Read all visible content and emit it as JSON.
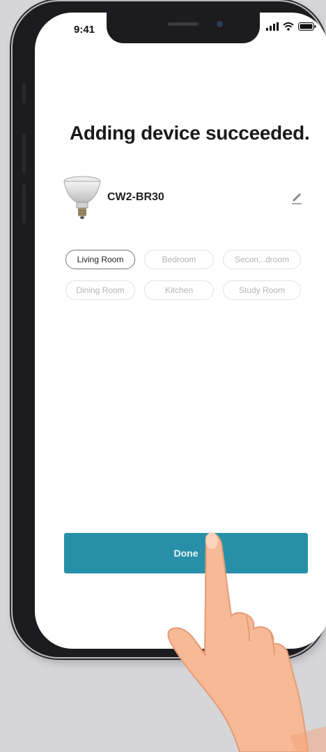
{
  "status_bar": {
    "time": "9:41"
  },
  "page": {
    "title": "Adding device succeeded."
  },
  "device": {
    "name": "CW2-BR30"
  },
  "rooms": [
    {
      "label": "Living Room",
      "selected": true
    },
    {
      "label": "Bedroom",
      "selected": false
    },
    {
      "label": "Secon...droom",
      "selected": false
    },
    {
      "label": "Dining Room",
      "selected": false
    },
    {
      "label": "Kitchen",
      "selected": false
    },
    {
      "label": "Study Room",
      "selected": false
    }
  ],
  "actions": {
    "done_label": "Done"
  },
  "colors": {
    "accent": "#2790a8",
    "chip_selected_border": "#777777",
    "chip_border": "#e1e1e1"
  }
}
